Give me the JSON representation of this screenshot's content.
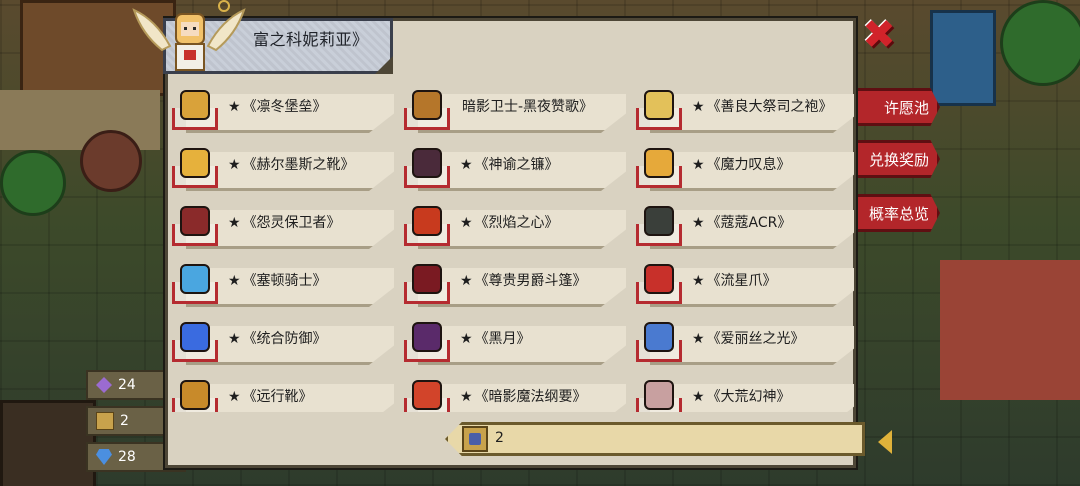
{
  "character": {
    "name": "富之科妮莉亚》"
  },
  "close": {
    "symbol": "✖"
  },
  "side_menu": [
    {
      "label": "许愿池"
    },
    {
      "label": "兑换奖励"
    },
    {
      "label": "概率总览"
    }
  ],
  "currency": [
    {
      "value": "24",
      "color": "#9b6bd1",
      "icon": "crystal-icon"
    },
    {
      "value": "2",
      "color": "#c8a24c",
      "icon": "token-icon"
    },
    {
      "value": "28",
      "color": "#4b8fe0",
      "icon": "diamond-icon"
    }
  ],
  "items": [
    {
      "star": "★",
      "name": "《凛冬堡垒》",
      "icon": "armor-icon",
      "color": "#d9a23a"
    },
    {
      "star": "",
      "name": "暗影卫士-黑夜赞歌》",
      "icon": "chest-icon",
      "color": "#b5762a"
    },
    {
      "star": "★",
      "name": "《善良大祭司之袍》",
      "icon": "robe-icon",
      "color": "#e3c15a"
    },
    {
      "star": "★",
      "name": "《赫尔墨斯之靴》",
      "icon": "boots-icon",
      "color": "#e6b13c"
    },
    {
      "star": "★",
      "name": "《神谕之镰》",
      "icon": "scythe-icon",
      "color": "#4a2a3a"
    },
    {
      "star": "★",
      "name": "《魔力叹息》",
      "icon": "ring-icon",
      "color": "#e6a93a"
    },
    {
      "star": "★",
      "name": "《怨灵保卫者》",
      "icon": "gauntlet-icon",
      "color": "#8a2a2a"
    },
    {
      "star": "★",
      "name": "《烈焰之心》",
      "icon": "flame-icon",
      "color": "#c83a1e"
    },
    {
      "star": "★",
      "name": "《蔻蔻ACR》",
      "icon": "gun-icon",
      "color": "#3a3f3a"
    },
    {
      "star": "★",
      "name": "《塞顿骑士》",
      "icon": "helmet-icon",
      "color": "#4aa6e0"
    },
    {
      "star": "★",
      "name": "《尊贵男爵斗篷》",
      "icon": "cape-icon",
      "color": "#7a1a22"
    },
    {
      "star": "★",
      "name": "《流星爪》",
      "icon": "claw-icon",
      "color": "#c8302a"
    },
    {
      "star": "★",
      "name": "《统合防御》",
      "icon": "gem-amulet-icon",
      "color": "#3a6be0"
    },
    {
      "star": "★",
      "name": "《黑月》",
      "icon": "book-icon",
      "color": "#5a2a6a"
    },
    {
      "star": "★",
      "name": "《爱丽丝之光》",
      "icon": "battery-icon",
      "color": "#4a7ad0"
    },
    {
      "star": "★",
      "name": "《远行靴》",
      "icon": "boots2-icon",
      "color": "#c88a2a"
    },
    {
      "star": "★",
      "name": "《暗影魔法纲要》",
      "icon": "tome-icon",
      "color": "#d2442a"
    },
    {
      "star": "★",
      "name": "《大荒幻神》",
      "icon": "sword-icon",
      "color": "#c8a0a0"
    }
  ],
  "count": {
    "value": "2"
  }
}
